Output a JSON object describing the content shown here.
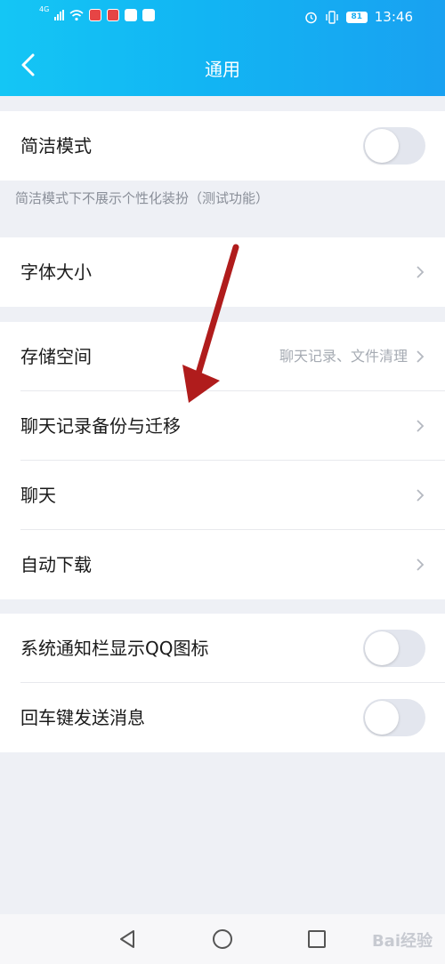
{
  "status_bar": {
    "network": "4G",
    "battery": "81",
    "time": "13:46"
  },
  "header": {
    "title": "通用"
  },
  "simple_mode": {
    "label": "简洁模式",
    "enabled": false,
    "caption": "简洁模式下不展示个性化装扮（测试功能）"
  },
  "font_size": {
    "label": "字体大小"
  },
  "storage_group": {
    "items": [
      {
        "label": "存储空间",
        "hint": "聊天记录、文件清理"
      },
      {
        "label": "聊天记录备份与迁移",
        "hint": ""
      },
      {
        "label": "聊天",
        "hint": ""
      },
      {
        "label": "自动下载",
        "hint": ""
      }
    ]
  },
  "toggle_group": {
    "items": [
      {
        "label": "系统通知栏显示QQ图标",
        "enabled": false
      },
      {
        "label": "回车键发送消息",
        "enabled": false
      }
    ]
  },
  "watermark": "Bai经验",
  "colors": {
    "header_start": "#14c6f5",
    "header_end": "#19a1f1",
    "arrow": "#b01c1c",
    "toggle_off": "#e3e6ee"
  }
}
